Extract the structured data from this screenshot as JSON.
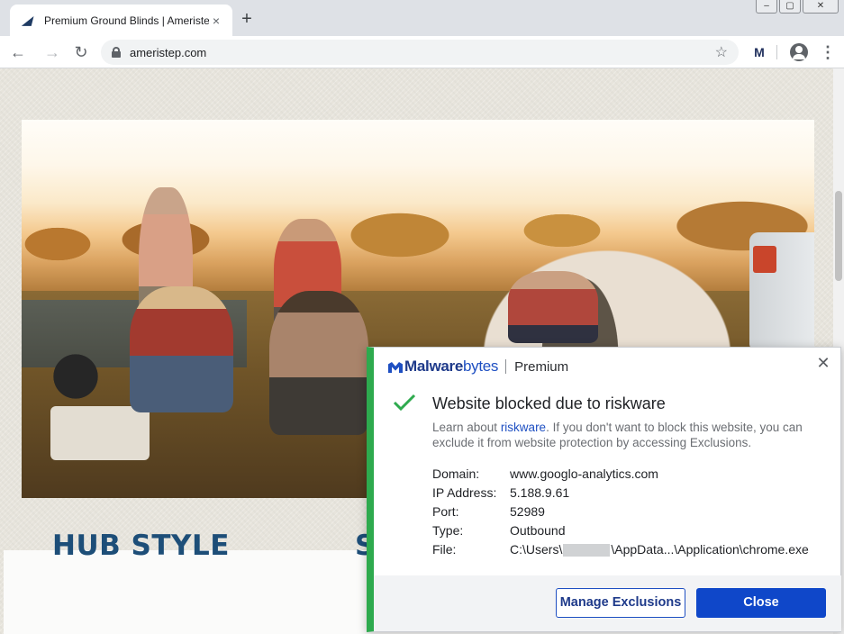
{
  "browser": {
    "tab_title": "Premium Ground Blinds | Ameristep",
    "tab_close": "×",
    "new_tab": "+",
    "url": "ameristep.com",
    "back": "←",
    "forward": "→",
    "reload": "↻",
    "bookmark": "☆",
    "extension": "M",
    "menu": "⋮",
    "window_controls": {
      "minimize": "–",
      "maximize": "▢",
      "close": "✕"
    },
    "icons": [
      "ameristep-favicon-icon",
      "lock-icon",
      "star-icon",
      "malwarebytes-extension-icon",
      "profile-icon",
      "kebab-menu-icon"
    ]
  },
  "page": {
    "section_title": "HUB STYLE",
    "section_title_partial": "S"
  },
  "popup": {
    "brand_bold": "Malware",
    "brand_regular": "bytes",
    "edition": "Premium",
    "close": "✕",
    "title": "Website blocked due to riskware",
    "desc_prefix": "Learn about ",
    "desc_link": "riskware",
    "desc_suffix": ". If you don't want to block this website, you can exclude it from website protection by accessing Exclusions.",
    "details": [
      {
        "label": "Domain:",
        "value": "www.googlo-analytics.com"
      },
      {
        "label": "IP Address:",
        "value": "5.188.9.61"
      },
      {
        "label": "Port:",
        "value": "52989"
      },
      {
        "label": "Type:",
        "value": "Outbound"
      }
    ],
    "file_label": "File:",
    "file_prefix": "C:\\Users\\",
    "file_suffix": "\\AppData...\\Application\\chrome.exe",
    "manage_button": "Manage Exclusions",
    "close_button": "Close",
    "accent": "#2eaa4e",
    "brand_color": "#1e4fc2"
  }
}
